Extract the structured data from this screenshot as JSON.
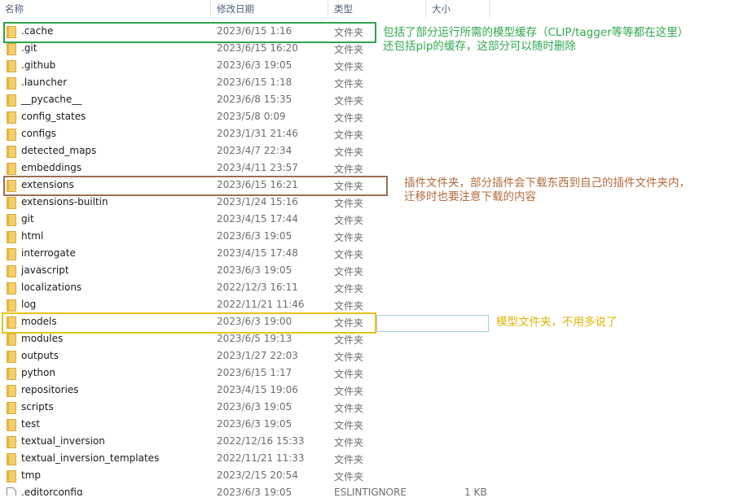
{
  "header": {
    "name": "名称",
    "date": "修改日期",
    "type": "类型",
    "size": "大小"
  },
  "colors": {
    "green": "#2ea44f",
    "brown": "#9a7052",
    "yellow": "#e6c31b",
    "note_green": "#2fa84f",
    "note_brown": "#b26a3b",
    "note_yellow": "#e0b400",
    "folder": "#f5cf6a"
  },
  "files": [
    {
      "name": ".cache",
      "date": "2023/6/15 1:16",
      "type": "文件夹",
      "icon": "folder-icon"
    },
    {
      "name": ".git",
      "date": "2023/6/15 16:20",
      "type": "文件夹",
      "icon": "folder-icon"
    },
    {
      "name": ".github",
      "date": "2023/6/3 19:05",
      "type": "文件夹",
      "icon": "folder-icon"
    },
    {
      "name": ".launcher",
      "date": "2023/6/15 1:18",
      "type": "文件夹",
      "icon": "folder-icon"
    },
    {
      "name": "__pycache__",
      "date": "2023/6/8 15:35",
      "type": "文件夹",
      "icon": "folder-icon"
    },
    {
      "name": "config_states",
      "date": "2023/5/8 0:09",
      "type": "文件夹",
      "icon": "folder-icon"
    },
    {
      "name": "configs",
      "date": "2023/1/31 21:46",
      "type": "文件夹",
      "icon": "folder-icon"
    },
    {
      "name": "detected_maps",
      "date": "2023/4/7 22:34",
      "type": "文件夹",
      "icon": "folder-icon"
    },
    {
      "name": "embeddings",
      "date": "2023/4/11 23:57",
      "type": "文件夹",
      "icon": "folder-icon"
    },
    {
      "name": "extensions",
      "date": "2023/6/15 16:21",
      "type": "文件夹",
      "icon": "folder-icon"
    },
    {
      "name": "extensions-builtin",
      "date": "2023/1/24 15:16",
      "type": "文件夹",
      "icon": "folder-icon"
    },
    {
      "name": "git",
      "date": "2023/4/15 17:44",
      "type": "文件夹",
      "icon": "folder-icon"
    },
    {
      "name": "html",
      "date": "2023/6/3 19:05",
      "type": "文件夹",
      "icon": "folder-icon"
    },
    {
      "name": "interrogate",
      "date": "2023/4/15 17:48",
      "type": "文件夹",
      "icon": "folder-icon"
    },
    {
      "name": "javascript",
      "date": "2023/6/3 19:05",
      "type": "文件夹",
      "icon": "folder-icon"
    },
    {
      "name": "localizations",
      "date": "2022/12/3 16:11",
      "type": "文件夹",
      "icon": "folder-icon"
    },
    {
      "name": "log",
      "date": "2022/11/21 11:46",
      "type": "文件夹",
      "icon": "folder-icon"
    },
    {
      "name": "models",
      "date": "2023/6/3 19:00",
      "type": "文件夹",
      "icon": "folder-icon"
    },
    {
      "name": "modules",
      "date": "2023/6/5 19:13",
      "type": "文件夹",
      "icon": "folder-icon"
    },
    {
      "name": "outputs",
      "date": "2023/1/27 22:03",
      "type": "文件夹",
      "icon": "folder-icon"
    },
    {
      "name": "python",
      "date": "2023/6/15 1:17",
      "type": "文件夹",
      "icon": "folder-icon"
    },
    {
      "name": "repositories",
      "date": "2023/4/15 19:06",
      "type": "文件夹",
      "icon": "folder-icon"
    },
    {
      "name": "scripts",
      "date": "2023/6/3 19:05",
      "type": "文件夹",
      "icon": "folder-icon"
    },
    {
      "name": "test",
      "date": "2023/6/3 19:05",
      "type": "文件夹",
      "icon": "folder-icon"
    },
    {
      "name": "textual_inversion",
      "date": "2022/12/16 15:33",
      "type": "文件夹",
      "icon": "folder-icon"
    },
    {
      "name": "textual_inversion_templates",
      "date": "2022/11/21 11:33",
      "type": "文件夹",
      "icon": "folder-icon"
    },
    {
      "name": "tmp",
      "date": "2023/2/15 20:54",
      "type": "文件夹",
      "icon": "folder-icon"
    },
    {
      "name": ".editorconfig",
      "date": "2023/6/3 19:05",
      "type": "ESLINTIGNORE",
      "size": "1 KB",
      "icon": "file-icon"
    }
  ],
  "annotations": {
    "cache_line1": "包括了部分运行所需的模型缓存（CLIP/tagger等等都在这里）",
    "cache_line2": "还包括pip的缓存，这部分可以随时删除",
    "extensions_line1": "插件文件夹，部分插件会下载东西到自己的插件文件夹内，",
    "extensions_line2": "迁移时也要注意下载的内容",
    "models_line1": "模型文件夹，不用多说了"
  }
}
